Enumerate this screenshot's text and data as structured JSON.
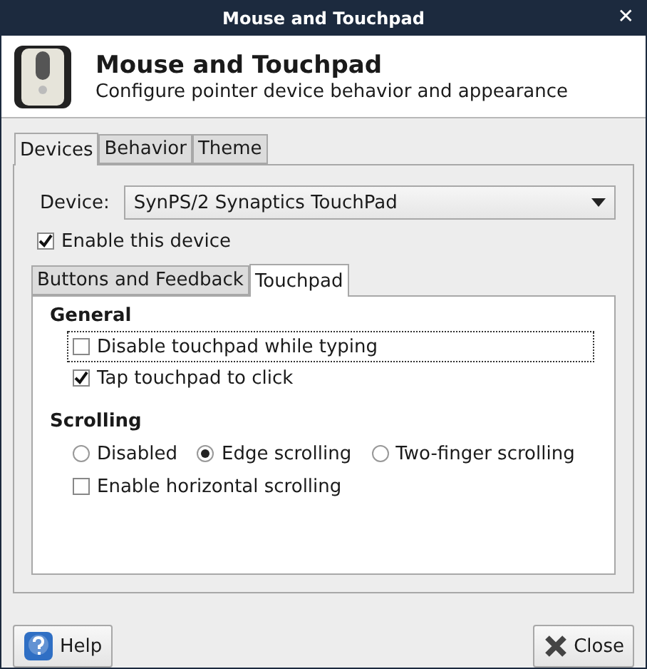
{
  "window": {
    "title": "Mouse and Touchpad",
    "close": "✕"
  },
  "header": {
    "title": "Mouse and Touchpad",
    "subtitle": "Configure pointer device behavior and appearance"
  },
  "tabs": [
    {
      "label": "Devices",
      "selected": true
    },
    {
      "label": "Behavior",
      "selected": false
    },
    {
      "label": "Theme",
      "selected": false
    }
  ],
  "device": {
    "label": "Device:",
    "value": "SynPS/2 Synaptics TouchPad"
  },
  "enable_device": {
    "label": "Enable this device",
    "checked": true
  },
  "inner_tabs": [
    {
      "label": "Buttons and Feedback",
      "selected": false
    },
    {
      "label": "Touchpad",
      "selected": true
    }
  ],
  "general": {
    "title": "General",
    "options": [
      {
        "label": "Disable touchpad while typing",
        "checked": false,
        "focused": true
      },
      {
        "label": "Tap touchpad to click",
        "checked": true,
        "focused": false
      }
    ]
  },
  "scrolling": {
    "title": "Scrolling",
    "modes": [
      {
        "label": "Disabled",
        "selected": false
      },
      {
        "label": "Edge scrolling",
        "selected": true
      },
      {
        "label": "Two-finger scrolling",
        "selected": false
      }
    ],
    "horizontal": {
      "label": "Enable horizontal scrolling",
      "checked": false
    }
  },
  "buttons": [
    {
      "kind": "help",
      "label": "Help"
    },
    {
      "kind": "close",
      "label": "Close"
    }
  ]
}
